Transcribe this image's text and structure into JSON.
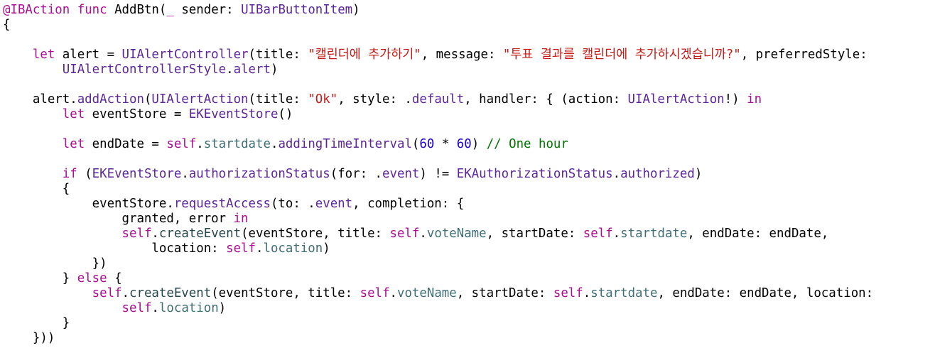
{
  "colors": {
    "plain": "#000000",
    "keyword": "#aa0d91",
    "type": "#5c2699",
    "string": "#c41a16",
    "number": "#1c00cf",
    "comment": "#007400",
    "property": "#3f6e74",
    "method": "#26474b"
  },
  "code_lines": [
    [
      {
        "t": "@IBAction",
        "k": "keyword"
      },
      {
        "t": " ",
        "k": "plain"
      },
      {
        "t": "func",
        "k": "keyword"
      },
      {
        "t": " AddBtn(",
        "k": "plain"
      },
      {
        "t": "_",
        "k": "keyword"
      },
      {
        "t": " sender: ",
        "k": "plain"
      },
      {
        "t": "UIBarButtonItem",
        "k": "type"
      },
      {
        "t": ")",
        "k": "plain"
      }
    ],
    [
      {
        "t": "{",
        "k": "plain"
      }
    ],
    [],
    [
      {
        "t": "    ",
        "k": "plain"
      },
      {
        "t": "let",
        "k": "keyword"
      },
      {
        "t": " alert = ",
        "k": "plain"
      },
      {
        "t": "UIAlertController",
        "k": "type"
      },
      {
        "t": "(title: ",
        "k": "plain"
      },
      {
        "t": "\"캘린더에 추가하기\"",
        "k": "string"
      },
      {
        "t": ", message: ",
        "k": "plain"
      },
      {
        "t": "\"투표 결과를 캘린더에 추가하시겠습니까?\"",
        "k": "string"
      },
      {
        "t": ", preferredStyle:",
        "k": "plain"
      }
    ],
    [
      {
        "t": "        ",
        "k": "plain"
      },
      {
        "t": "UIAlertControllerStyle",
        "k": "type"
      },
      {
        "t": ".",
        "k": "plain"
      },
      {
        "t": "alert",
        "k": "type"
      },
      {
        "t": ")",
        "k": "plain"
      }
    ],
    [],
    [
      {
        "t": "    alert.",
        "k": "plain"
      },
      {
        "t": "addAction",
        "k": "type"
      },
      {
        "t": "(",
        "k": "plain"
      },
      {
        "t": "UIAlertAction",
        "k": "type"
      },
      {
        "t": "(title: ",
        "k": "plain"
      },
      {
        "t": "\"Ok\"",
        "k": "string"
      },
      {
        "t": ", style: .",
        "k": "plain"
      },
      {
        "t": "default",
        "k": "type"
      },
      {
        "t": ", handler: { (action: ",
        "k": "plain"
      },
      {
        "t": "UIAlertAction",
        "k": "type"
      },
      {
        "t": "!) ",
        "k": "plain"
      },
      {
        "t": "in",
        "k": "keyword"
      }
    ],
    [
      {
        "t": "        ",
        "k": "plain"
      },
      {
        "t": "let",
        "k": "keyword"
      },
      {
        "t": " eventStore = ",
        "k": "plain"
      },
      {
        "t": "EKEventStore",
        "k": "type"
      },
      {
        "t": "()",
        "k": "plain"
      }
    ],
    [],
    [
      {
        "t": "        ",
        "k": "plain"
      },
      {
        "t": "let",
        "k": "keyword"
      },
      {
        "t": " endDate = ",
        "k": "plain"
      },
      {
        "t": "self",
        "k": "keyword"
      },
      {
        "t": ".",
        "k": "plain"
      },
      {
        "t": "startdate",
        "k": "property"
      },
      {
        "t": ".",
        "k": "plain"
      },
      {
        "t": "addingTimeInterval",
        "k": "type"
      },
      {
        "t": "(",
        "k": "plain"
      },
      {
        "t": "60",
        "k": "number"
      },
      {
        "t": " * ",
        "k": "plain"
      },
      {
        "t": "60",
        "k": "number"
      },
      {
        "t": ") ",
        "k": "plain"
      },
      {
        "t": "// One hour",
        "k": "comment"
      }
    ],
    [],
    [
      {
        "t": "        ",
        "k": "plain"
      },
      {
        "t": "if",
        "k": "keyword"
      },
      {
        "t": " (",
        "k": "plain"
      },
      {
        "t": "EKEventStore",
        "k": "type"
      },
      {
        "t": ".",
        "k": "plain"
      },
      {
        "t": "authorizationStatus",
        "k": "type"
      },
      {
        "t": "(for: .",
        "k": "plain"
      },
      {
        "t": "event",
        "k": "type"
      },
      {
        "t": ") != ",
        "k": "plain"
      },
      {
        "t": "EKAuthorizationStatus",
        "k": "type"
      },
      {
        "t": ".",
        "k": "plain"
      },
      {
        "t": "authorized",
        "k": "type"
      },
      {
        "t": ")",
        "k": "plain"
      }
    ],
    [
      {
        "t": "        {",
        "k": "plain"
      }
    ],
    [
      {
        "t": "            eventStore.",
        "k": "plain"
      },
      {
        "t": "requestAccess",
        "k": "type"
      },
      {
        "t": "(to: .",
        "k": "plain"
      },
      {
        "t": "event",
        "k": "type"
      },
      {
        "t": ", completion: {",
        "k": "plain"
      }
    ],
    [
      {
        "t": "                granted, error ",
        "k": "plain"
      },
      {
        "t": "in",
        "k": "keyword"
      }
    ],
    [
      {
        "t": "                ",
        "k": "plain"
      },
      {
        "t": "self",
        "k": "keyword"
      },
      {
        "t": ".",
        "k": "plain"
      },
      {
        "t": "createEvent",
        "k": "method"
      },
      {
        "t": "(eventStore, title: ",
        "k": "plain"
      },
      {
        "t": "self",
        "k": "keyword"
      },
      {
        "t": ".",
        "k": "plain"
      },
      {
        "t": "voteName",
        "k": "property"
      },
      {
        "t": ", startDate: ",
        "k": "plain"
      },
      {
        "t": "self",
        "k": "keyword"
      },
      {
        "t": ".",
        "k": "plain"
      },
      {
        "t": "startdate",
        "k": "property"
      },
      {
        "t": ", endDate: endDate,",
        "k": "plain"
      }
    ],
    [
      {
        "t": "                    location: ",
        "k": "plain"
      },
      {
        "t": "self",
        "k": "keyword"
      },
      {
        "t": ".",
        "k": "plain"
      },
      {
        "t": "location",
        "k": "property"
      },
      {
        "t": ")",
        "k": "plain"
      }
    ],
    [
      {
        "t": "            })",
        "k": "plain"
      }
    ],
    [
      {
        "t": "        } ",
        "k": "plain"
      },
      {
        "t": "else",
        "k": "keyword"
      },
      {
        "t": " {",
        "k": "plain"
      }
    ],
    [
      {
        "t": "            ",
        "k": "plain"
      },
      {
        "t": "self",
        "k": "keyword"
      },
      {
        "t": ".",
        "k": "plain"
      },
      {
        "t": "createEvent",
        "k": "method"
      },
      {
        "t": "(eventStore, title: ",
        "k": "plain"
      },
      {
        "t": "self",
        "k": "keyword"
      },
      {
        "t": ".",
        "k": "plain"
      },
      {
        "t": "voteName",
        "k": "property"
      },
      {
        "t": ", startDate: ",
        "k": "plain"
      },
      {
        "t": "self",
        "k": "keyword"
      },
      {
        "t": ".",
        "k": "plain"
      },
      {
        "t": "startdate",
        "k": "property"
      },
      {
        "t": ", endDate: endDate, location:",
        "k": "plain"
      }
    ],
    [
      {
        "t": "                ",
        "k": "plain"
      },
      {
        "t": "self",
        "k": "keyword"
      },
      {
        "t": ".",
        "k": "plain"
      },
      {
        "t": "location",
        "k": "property"
      },
      {
        "t": ")",
        "k": "plain"
      }
    ],
    [
      {
        "t": "        }",
        "k": "plain"
      }
    ],
    [
      {
        "t": "    }))",
        "k": "plain"
      }
    ]
  ]
}
